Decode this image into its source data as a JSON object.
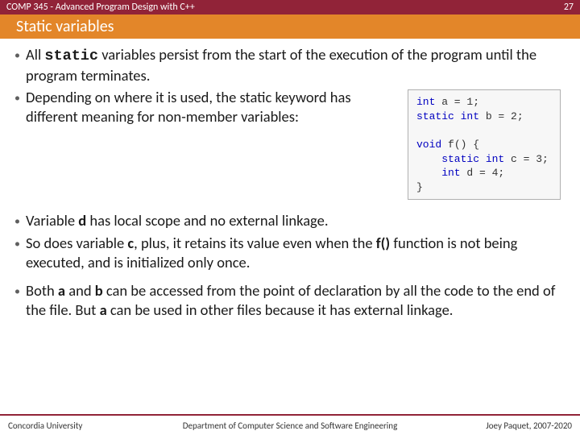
{
  "header": {
    "course": "COMP 345 - Advanced Program Design with C++",
    "page_number": "27",
    "slide_title": "Static variables"
  },
  "bullets": {
    "b1_pre": "All ",
    "b1_kw": "static",
    "b1_post": " variables persist from the start of the execution of the program until the program terminates.",
    "b2": "Depending on where it is used, the static keyword has different meaning for non-member variables:",
    "b3_pre": "Variable ",
    "b3_var": "d",
    "b3_post": " has local scope and no external linkage.",
    "b4_pre": "So does variable ",
    "b4_var": "c",
    "b4_mid": ", plus, it retains its value even when the ",
    "b4_fn": "f()",
    "b4_post": " function is not being executed, and is initialized only once.",
    "b5_pre": "Both ",
    "b5_a": "a",
    "b5_mid1": " and ",
    "b5_b": "b",
    "b5_mid2": " can be accessed from the point of declaration by all the code to the end of the file. But ",
    "b5_a2": "a",
    "b5_post": " can be used in other files because it has external linkage."
  },
  "code": {
    "l1a": "int",
    "l1b": " a = 1;",
    "l2a": "static int",
    "l2b": " b = 2;",
    "l3": "",
    "l4a": "void",
    "l4b": " f() {",
    "l5a": "    static int",
    "l5b": " c = 3;",
    "l6a": "    int",
    "l6b": " d = 4;",
    "l7": "}"
  },
  "footer": {
    "left": "Concordia University",
    "center": "Department of Computer Science and Software Engineering",
    "right": "Joey Paquet, 2007-2020"
  }
}
